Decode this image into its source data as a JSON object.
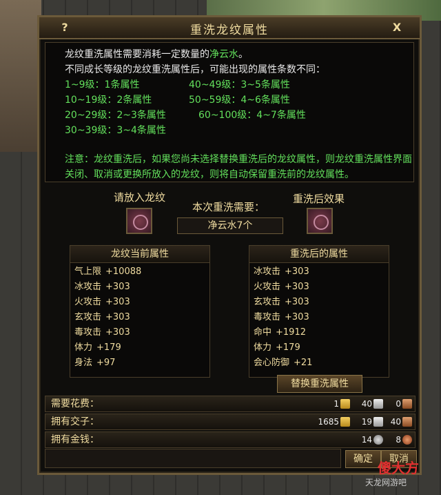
{
  "window": {
    "title": "重洗龙纹属性",
    "help": "?",
    "close": "X"
  },
  "info": {
    "line1_pre": "龙纹重洗属性需要消耗一定数量的",
    "line1_hl": "净云水",
    "line1_post": "。",
    "line2": "不同成长等级的龙纹重洗属性后，可能出现的属性条数不同：",
    "levels": [
      {
        "range": "1~9级：",
        "count": "1条属性"
      },
      {
        "range": "10~19级：",
        "count": "2条属性"
      },
      {
        "range": "20~29级：",
        "count": "2~3条属性"
      },
      {
        "range": "30~39级：",
        "count": "3~4条属性"
      },
      {
        "range": "40~49级：",
        "count": "3~5条属性"
      },
      {
        "range": "50~59级：",
        "count": "4~6条属性"
      },
      {
        "range": "60~100级：",
        "count": "4~7条属性"
      }
    ],
    "note": "注意：龙纹重洗后，如果您尚未选择替换重洗后的龙纹属性，则龙纹重洗属性界面关闭、取消或更换所放入的龙纹，则将自动保留重洗前的龙纹属性。"
  },
  "slots": {
    "put_label": "请放入龙纹",
    "need_label": "本次重洗需要：",
    "need_value": "净云水7个",
    "result_label": "重洗后效果"
  },
  "current": {
    "header": "龙纹当前属性",
    "attrs": [
      {
        "name": "气上限",
        "value": "+10088"
      },
      {
        "name": "冰攻击",
        "value": "+303"
      },
      {
        "name": "火攻击",
        "value": "+303"
      },
      {
        "name": "玄攻击",
        "value": "+303"
      },
      {
        "name": "毒攻击",
        "value": "+303"
      },
      {
        "name": "体力",
        "value": "+179"
      },
      {
        "name": "身法",
        "value": "+97"
      }
    ]
  },
  "after": {
    "header": "重洗后的属性",
    "attrs": [
      {
        "name": "冰攻击",
        "value": "+303"
      },
      {
        "name": "火攻击",
        "value": "+303"
      },
      {
        "name": "玄攻击",
        "value": "+303"
      },
      {
        "name": "毒攻击",
        "value": "+303"
      },
      {
        "name": "命中",
        "value": "+1912"
      },
      {
        "name": "体力",
        "value": "+179"
      },
      {
        "name": "会心防御",
        "value": "+21"
      }
    ]
  },
  "swap_button": "替换重洗属性",
  "costs": {
    "need": {
      "label": "需要花费：",
      "gold": "1",
      "silver": "40",
      "copper": "0"
    },
    "jiaozi": {
      "label": "拥有交子：",
      "gold": "1685",
      "silver": "19",
      "copper": "40"
    },
    "money": {
      "label": "拥有金钱：",
      "silver": "14",
      "copper": "8"
    }
  },
  "buttons": {
    "ok": "确定",
    "cancel": "取消"
  },
  "watermark": {
    "logo": "傻大方",
    "text": "天龙网游吧"
  }
}
